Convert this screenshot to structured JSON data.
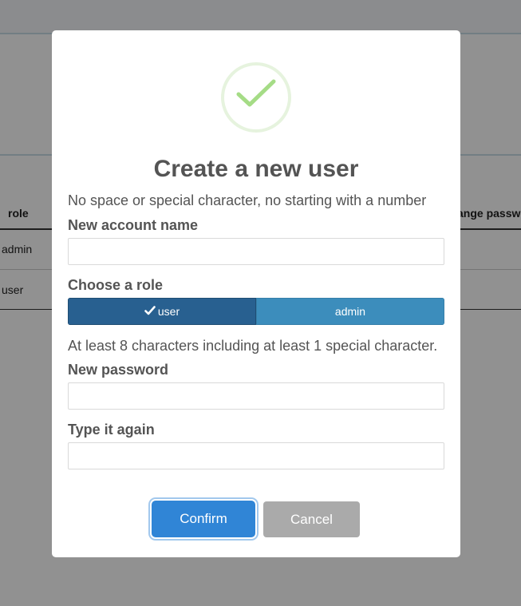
{
  "background": {
    "table": {
      "headers": {
        "role": "role",
        "change_password": "ange passw"
      },
      "rows": [
        {
          "role": "admin"
        },
        {
          "role": "user"
        }
      ]
    }
  },
  "modal": {
    "title": "Create a new user",
    "account_hint": "No space or special character, no starting with a number",
    "account_label": "New account name",
    "account_value": "",
    "role_label": "Choose a role",
    "roles": [
      {
        "label": "user",
        "selected": true
      },
      {
        "label": "admin",
        "selected": false
      }
    ],
    "password_hint": "At least 8 characters including at least 1 special character.",
    "password_label": "New password",
    "password_value": "",
    "confirm_label": "Type it again",
    "confirm_value": "",
    "confirm_button": "Confirm",
    "cancel_button": "Cancel"
  },
  "icons": {
    "success": "check-circle-icon",
    "selected_role": "check-icon"
  },
  "colors": {
    "confirm": "#3085d6",
    "cancel": "#aaaaaa",
    "role_selected": "#286090",
    "role_unselected": "#3c8dbc",
    "success": "#a5dc86"
  }
}
